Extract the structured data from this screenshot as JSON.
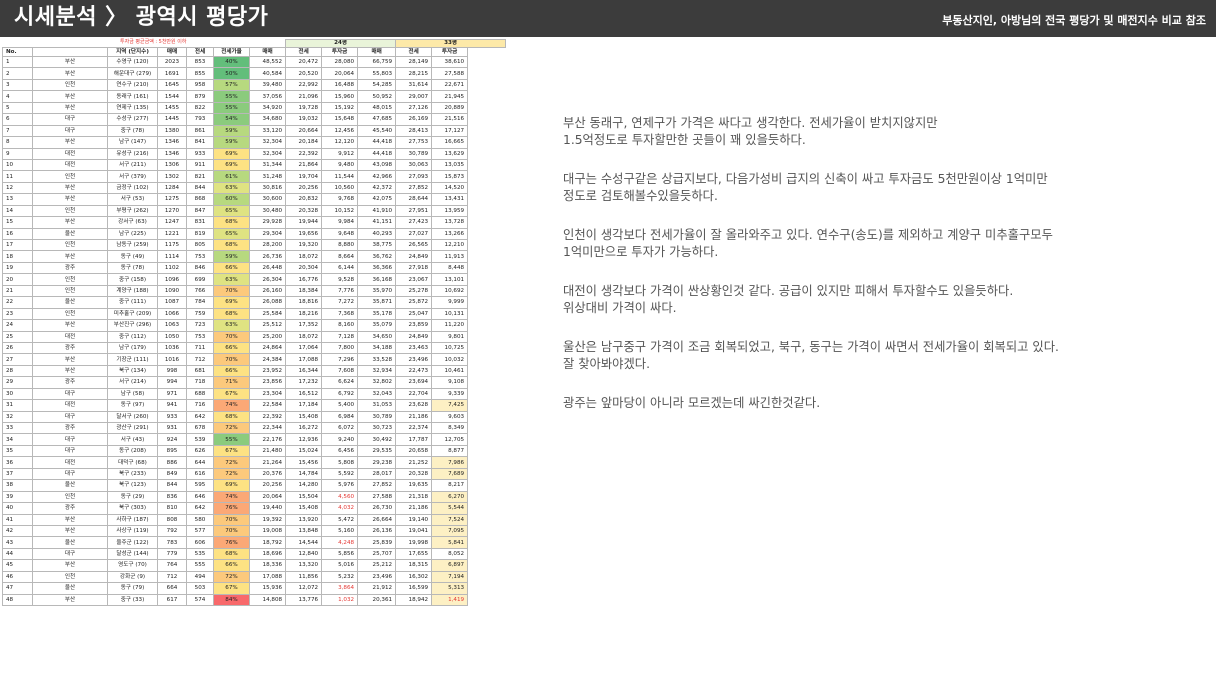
{
  "header": {
    "title": "시세분석 〉 광역시 평당가",
    "subtitle": "부동산지인, 아방님의 전국 평당가 및 매전지수 비교 참조"
  },
  "table": {
    "note": "투자금 평균금액 : 5천만원 이하",
    "group_24": "24평",
    "group_33": "33평",
    "headers": [
      "No.",
      "지역 (단지수)",
      "매매",
      "전세",
      "전세가율",
      "매매",
      "전세",
      "투자금",
      "매매",
      "전세",
      "투자금"
    ],
    "rows": [
      [
        "1",
        "부산",
        "수영구 (120)",
        "2023",
        "853",
        "40%",
        "48,552",
        "20,472",
        "28,080",
        "66,759",
        "28,149",
        "38,610"
      ],
      [
        "2",
        "부산",
        "해운대구 (279)",
        "1691",
        "855",
        "50%",
        "40,584",
        "20,520",
        "20,064",
        "55,803",
        "28,215",
        "27,588"
      ],
      [
        "3",
        "인천",
        "연수구 (210)",
        "1645",
        "958",
        "57%",
        "39,480",
        "22,992",
        "16,488",
        "54,285",
        "31,614",
        "22,671"
      ],
      [
        "4",
        "부산",
        "동래구 (161)",
        "1544",
        "879",
        "55%",
        "37,056",
        "21,096",
        "15,960",
        "50,952",
        "29,007",
        "21,945"
      ],
      [
        "5",
        "부산",
        "연제구 (135)",
        "1455",
        "822",
        "55%",
        "34,920",
        "19,728",
        "15,192",
        "48,015",
        "27,126",
        "20,889"
      ],
      [
        "6",
        "대구",
        "수성구 (277)",
        "1445",
        "793",
        "54%",
        "34,680",
        "19,032",
        "15,648",
        "47,685",
        "26,169",
        "21,516"
      ],
      [
        "7",
        "대구",
        "중구 (78)",
        "1380",
        "861",
        "59%",
        "33,120",
        "20,664",
        "12,456",
        "45,540",
        "28,413",
        "17,127"
      ],
      [
        "8",
        "부산",
        "남구 (147)",
        "1346",
        "841",
        "59%",
        "32,304",
        "20,184",
        "12,120",
        "44,418",
        "27,753",
        "16,665"
      ],
      [
        "9",
        "대전",
        "유성구 (216)",
        "1346",
        "933",
        "69%",
        "32,304",
        "22,392",
        "9,912",
        "44,418",
        "30,789",
        "13,629"
      ],
      [
        "10",
        "대전",
        "서구 (211)",
        "1306",
        "911",
        "69%",
        "31,344",
        "21,864",
        "9,480",
        "43,098",
        "30,063",
        "13,035"
      ],
      [
        "11",
        "인천",
        "서구 (379)",
        "1302",
        "821",
        "61%",
        "31,248",
        "19,704",
        "11,544",
        "42,966",
        "27,093",
        "15,873"
      ],
      [
        "12",
        "부산",
        "금정구 (102)",
        "1284",
        "844",
        "63%",
        "30,816",
        "20,256",
        "10,560",
        "42,372",
        "27,852",
        "14,520"
      ],
      [
        "13",
        "부산",
        "서구 (53)",
        "1275",
        "868",
        "60%",
        "30,600",
        "20,832",
        "9,768",
        "42,075",
        "28,644",
        "13,431"
      ],
      [
        "14",
        "인천",
        "부평구 (262)",
        "1270",
        "847",
        "65%",
        "30,480",
        "20,328",
        "10,152",
        "41,910",
        "27,951",
        "13,959"
      ],
      [
        "15",
        "부산",
        "강서구 (63)",
        "1247",
        "831",
        "68%",
        "29,928",
        "19,944",
        "9,984",
        "41,151",
        "27,423",
        "13,728"
      ],
      [
        "16",
        "울산",
        "남구 (225)",
        "1221",
        "819",
        "65%",
        "29,304",
        "19,656",
        "9,648",
        "40,293",
        "27,027",
        "13,266"
      ],
      [
        "17",
        "인천",
        "남동구 (259)",
        "1175",
        "805",
        "68%",
        "28,200",
        "19,320",
        "8,880",
        "38,775",
        "26,565",
        "12,210"
      ],
      [
        "18",
        "부산",
        "동구 (49)",
        "1114",
        "753",
        "59%",
        "26,736",
        "18,072",
        "8,664",
        "36,762",
        "24,849",
        "11,913"
      ],
      [
        "19",
        "광주",
        "동구 (78)",
        "1102",
        "846",
        "66%",
        "26,448",
        "20,304",
        "6,144",
        "36,366",
        "27,918",
        "8,448"
      ],
      [
        "20",
        "인천",
        "중구 (158)",
        "1096",
        "699",
        "63%",
        "26,304",
        "16,776",
        "9,528",
        "36,168",
        "23,067",
        "13,101"
      ],
      [
        "21",
        "인천",
        "계양구 (188)",
        "1090",
        "766",
        "70%",
        "26,160",
        "18,384",
        "7,776",
        "35,970",
        "25,278",
        "10,692"
      ],
      [
        "22",
        "울산",
        "중구 (111)",
        "1087",
        "784",
        "69%",
        "26,088",
        "18,816",
        "7,272",
        "35,871",
        "25,872",
        "9,999"
      ],
      [
        "23",
        "인천",
        "미추홀구 (209)",
        "1066",
        "759",
        "68%",
        "25,584",
        "18,216",
        "7,368",
        "35,178",
        "25,047",
        "10,131"
      ],
      [
        "24",
        "부산",
        "부산진구 (296)",
        "1063",
        "723",
        "63%",
        "25,512",
        "17,352",
        "8,160",
        "35,079",
        "23,859",
        "11,220"
      ],
      [
        "25",
        "대전",
        "중구 (112)",
        "1050",
        "753",
        "70%",
        "25,200",
        "18,072",
        "7,128",
        "34,650",
        "24,849",
        "9,801"
      ],
      [
        "26",
        "광주",
        "남구 (179)",
        "1036",
        "711",
        "66%",
        "24,864",
        "17,064",
        "7,800",
        "34,188",
        "23,463",
        "10,725"
      ],
      [
        "27",
        "부산",
        "기장군 (111)",
        "1016",
        "712",
        "70%",
        "24,384",
        "17,088",
        "7,296",
        "33,528",
        "23,496",
        "10,032"
      ],
      [
        "28",
        "부산",
        "북구 (134)",
        "998",
        "681",
        "66%",
        "23,952",
        "16,344",
        "7,608",
        "32,934",
        "22,473",
        "10,461"
      ],
      [
        "29",
        "광주",
        "서구 (214)",
        "994",
        "718",
        "71%",
        "23,856",
        "17,232",
        "6,624",
        "32,802",
        "23,694",
        "9,108"
      ],
      [
        "30",
        "대구",
        "남구 (58)",
        "971",
        "688",
        "67%",
        "23,304",
        "16,512",
        "6,792",
        "32,043",
        "22,704",
        "9,339"
      ],
      [
        "31",
        "대전",
        "동구 (97)",
        "941",
        "716",
        "74%",
        "22,584",
        "17,184",
        "5,400",
        "31,053",
        "23,628",
        "7,425"
      ],
      [
        "32",
        "대구",
        "달서구 (260)",
        "933",
        "642",
        "68%",
        "22,392",
        "15,408",
        "6,984",
        "30,789",
        "21,186",
        "9,603"
      ],
      [
        "33",
        "광주",
        "광산구 (291)",
        "931",
        "678",
        "72%",
        "22,344",
        "16,272",
        "6,072",
        "30,723",
        "22,374",
        "8,349"
      ],
      [
        "34",
        "대구",
        "서구 (43)",
        "924",
        "539",
        "55%",
        "22,176",
        "12,936",
        "9,240",
        "30,492",
        "17,787",
        "12,705"
      ],
      [
        "35",
        "대구",
        "동구 (208)",
        "895",
        "626",
        "67%",
        "21,480",
        "15,024",
        "6,456",
        "29,535",
        "20,658",
        "8,877"
      ],
      [
        "36",
        "대전",
        "대덕구 (68)",
        "886",
        "644",
        "72%",
        "21,264",
        "15,456",
        "5,808",
        "29,238",
        "21,252",
        "7,986"
      ],
      [
        "37",
        "대구",
        "북구 (233)",
        "849",
        "616",
        "72%",
        "20,376",
        "14,784",
        "5,592",
        "28,017",
        "20,328",
        "7,689"
      ],
      [
        "38",
        "울산",
        "북구 (123)",
        "844",
        "595",
        "69%",
        "20,256",
        "14,280",
        "5,976",
        "27,852",
        "19,635",
        "8,217"
      ],
      [
        "39",
        "인천",
        "동구 (29)",
        "836",
        "646",
        "74%",
        "20,064",
        "15,504",
        "4,560",
        "27,588",
        "21,318",
        "6,270"
      ],
      [
        "40",
        "광주",
        "북구 (303)",
        "810",
        "642",
        "76%",
        "19,440",
        "15,408",
        "4,032",
        "26,730",
        "21,186",
        "5,544"
      ],
      [
        "41",
        "부산",
        "사하구 (187)",
        "808",
        "580",
        "70%",
        "19,392",
        "13,920",
        "5,472",
        "26,664",
        "19,140",
        "7,524"
      ],
      [
        "42",
        "부산",
        "사상구 (119)",
        "792",
        "577",
        "70%",
        "19,008",
        "13,848",
        "5,160",
        "26,136",
        "19,041",
        "7,095"
      ],
      [
        "43",
        "울산",
        "울주군 (122)",
        "783",
        "606",
        "76%",
        "18,792",
        "14,544",
        "4,248",
        "25,839",
        "19,998",
        "5,841"
      ],
      [
        "44",
        "대구",
        "달성군 (144)",
        "779",
        "535",
        "68%",
        "18,696",
        "12,840",
        "5,856",
        "25,707",
        "17,655",
        "8,052"
      ],
      [
        "45",
        "부산",
        "영도구 (70)",
        "764",
        "555",
        "66%",
        "18,336",
        "13,320",
        "5,016",
        "25,212",
        "18,315",
        "6,897"
      ],
      [
        "46",
        "인천",
        "강화군 (9)",
        "712",
        "494",
        "72%",
        "17,088",
        "11,856",
        "5,232",
        "23,496",
        "16,302",
        "7,194"
      ],
      [
        "47",
        "울산",
        "동구 (79)",
        "664",
        "503",
        "67%",
        "15,936",
        "12,072",
        "3,864",
        "21,912",
        "16,599",
        "5,313"
      ],
      [
        "48",
        "부산",
        "중구 (33)",
        "617",
        "574",
        "84%",
        "14,808",
        "13,776",
        "1,032",
        "20,361",
        "18,942",
        "1,419"
      ]
    ]
  },
  "commentary": [
    [
      "부산 동래구, 연제구가 가격은 싸다고 생각한다. 전세가율이 받치지않지만",
      "1.5억정도로 투자할만한 곳들이 꽤 있을듯하다."
    ],
    [
      "대구는 수성구같은 상급지보다, 다음가성비 급지의 신축이 싸고 투자금도 5천만원이상 1억미만",
      "정도로 검토해볼수있을듯하다."
    ],
    [
      "인천이 생각보다 전세가율이 잘 올라와주고 있다. 연수구(송도)를 제외하고 계양구 미추홀구모두",
      "1억미만으로 투자가 가능하다."
    ],
    [
      "대전이 생각보다 가격이 싼상황인것 같다. 공급이 있지만 피해서 투자할수도 있을듯하다.",
      "위상대비 가격이 싸다."
    ],
    [
      "울산은 남구중구 가격이 조금 회복되었고, 북구, 동구는 가격이 싸면서 전세가율이 회복되고 있다.",
      "잘 찾아봐야겠다."
    ],
    [
      "광주는 앞마당이 아니라 모르겠는데 싸긴한것같다."
    ]
  ]
}
